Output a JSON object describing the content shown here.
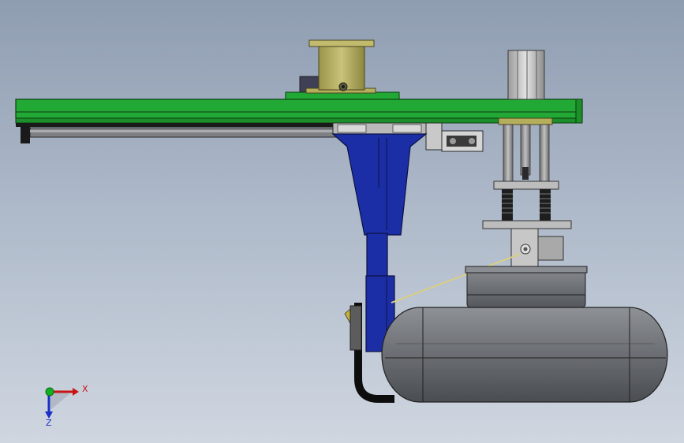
{
  "scene": {
    "background_top": "#8f9db1",
    "background_bottom": "#cfd6e0",
    "colors": {
      "beam": "#22a834",
      "column": "#1c2ea6",
      "tank": "#6e7176",
      "bracket": "#c9c9c9",
      "hose": "#0d0d0d",
      "spool": "#b5ae5c"
    },
    "parts": [
      "green-cross-beam",
      "linear-rail",
      "spool-drive",
      "vertical-column",
      "tank-assembly",
      "guide-rod-cylinder",
      "spring-mount",
      "cable-hose"
    ]
  },
  "triad": {
    "x_label": "X",
    "z_label": "Z",
    "x_color": "#c81414",
    "y_color": "#10b020",
    "z_color": "#1a2ec8"
  }
}
